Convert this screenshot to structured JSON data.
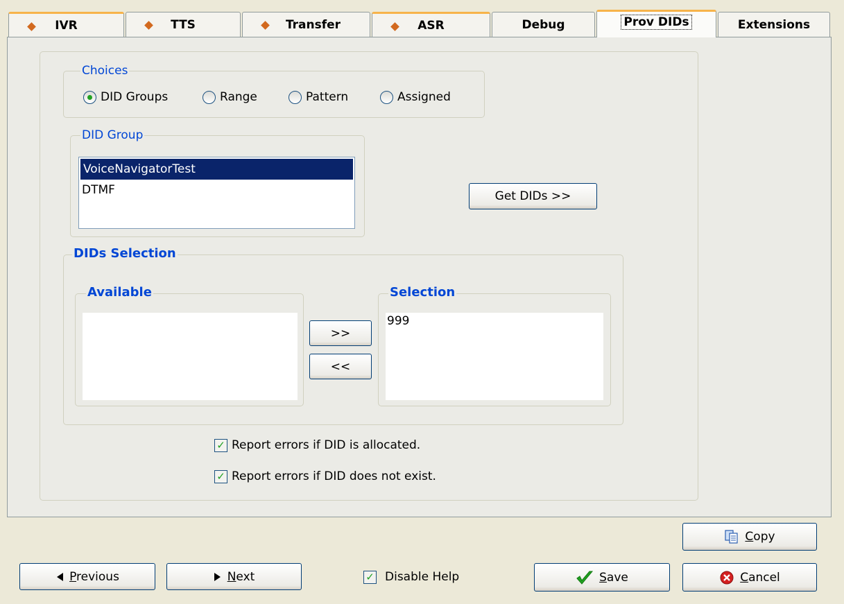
{
  "tabs": [
    {
      "label": "IVR",
      "diamond": true
    },
    {
      "label": "TTS",
      "diamond": true
    },
    {
      "label": "Transfer",
      "diamond": true
    },
    {
      "label": "ASR",
      "diamond": true
    },
    {
      "label": "Debug",
      "diamond": false
    },
    {
      "label": "Prov DIDs",
      "diamond": false,
      "active": true
    },
    {
      "label": "Extensions",
      "diamond": false
    }
  ],
  "choices": {
    "legend": "Choices",
    "options": [
      "DID Groups",
      "Range",
      "Pattern",
      "Assigned"
    ],
    "selected": "DID Groups"
  },
  "did_group": {
    "legend": "DID Group",
    "items": [
      "VoiceNavigatorTest",
      "DTMF"
    ],
    "selected": "VoiceNavigatorTest",
    "get_dids_label": "Get DIDs >>"
  },
  "dids_selection": {
    "legend": "DIDs Selection",
    "available_label": "Available",
    "available_items": [],
    "selection_label": "Selection",
    "selection_items": [
      "999"
    ],
    "add_label": ">>",
    "remove_label": "<<"
  },
  "options": {
    "report_allocated": {
      "label": "Report errors if DID is allocated.",
      "checked": true
    },
    "report_not_exist": {
      "label": "Report errors if DID does not exist.",
      "checked": true
    }
  },
  "footer": {
    "previous_label": "Previous",
    "next_label": "Next",
    "disable_help_label": "Disable Help",
    "disable_help_checked": true,
    "copy_label": "Copy",
    "save_label": "Save",
    "cancel_label": "Cancel"
  },
  "colors": {
    "accent": "#0046d5",
    "tab_highlight": "#f7b34a",
    "diamond": "#d2691e",
    "selection_bg": "#0a246a",
    "check_green": "#21a121",
    "cancel_red": "#d42020"
  }
}
